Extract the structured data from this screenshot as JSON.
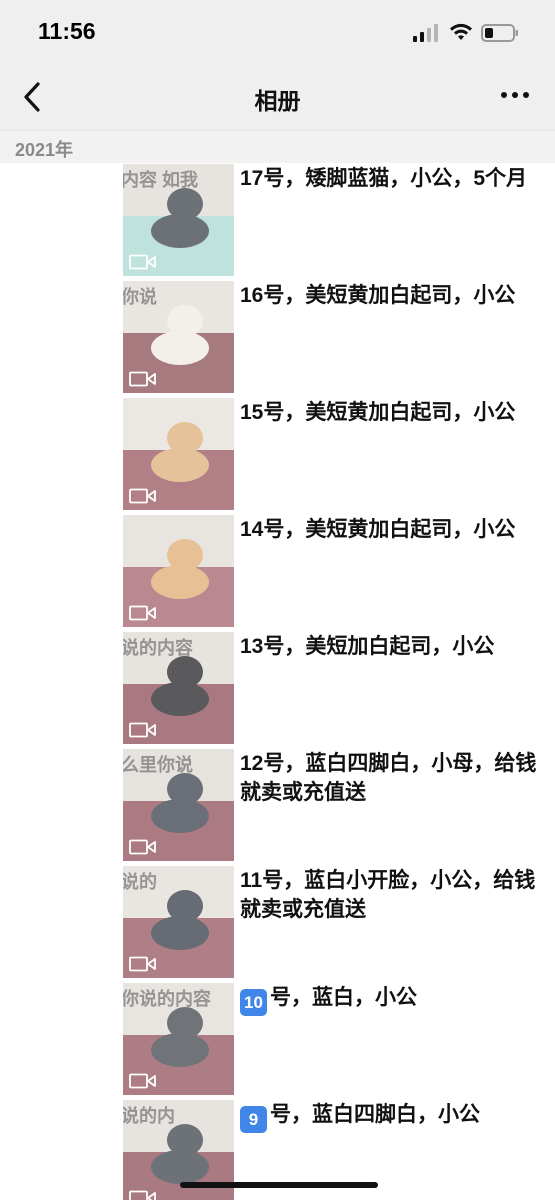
{
  "status_bar": {
    "time": "11:56"
  },
  "nav": {
    "title": "相册"
  },
  "year": "2021年",
  "items": [
    {
      "caption": "17号，矮脚蓝猫，小公，5个月",
      "wall": "#e7e4df",
      "floor": "#bfe2dc",
      "cat": "#6c7178",
      "wall_text": "内容  如我"
    },
    {
      "caption": "16号，美短黄加白起司，小公",
      "wall": "#e9e6e2",
      "floor": "#a77a80",
      "cat": "#f3efe9",
      "wall_text": "你说"
    },
    {
      "caption": "15号，美短黄加白起司，小公",
      "wall": "#ebe8e4",
      "floor": "#b27f86",
      "cat": "#e6c29b",
      "wall_text": ""
    },
    {
      "caption": "14号，美短黄加白起司，小公",
      "wall": "#e8e5e1",
      "floor": "#b98891",
      "cat": "#e8c096",
      "wall_text": ""
    },
    {
      "caption": "13号，美短加白起司，小公",
      "wall": "#e7e3de",
      "floor": "#a97880",
      "cat": "#5a5a5c",
      "wall_text": "说的内容"
    },
    {
      "caption": "12号，蓝白四脚白，小母，给钱就卖或充值送",
      "wall": "#e6e2dd",
      "floor": "#ab7a82",
      "cat": "#6a6e76",
      "wall_text": "么里你说"
    },
    {
      "caption": "11号，蓝白小开脸，小公，给钱就卖或充值送",
      "wall": "#e9e6e1",
      "floor": "#b07e86",
      "cat": "#676b73",
      "wall_text": "说的"
    },
    {
      "caption": "号，蓝白，小公",
      "badge": "10",
      "wall": "#e8e5e0",
      "floor": "#ad7c84",
      "cat": "#707479",
      "wall_text": "你说的内容"
    },
    {
      "caption": "号，蓝白四脚白，小公",
      "badge": "9",
      "wall": "#e7e4df",
      "floor": "#aa7a82",
      "cat": "#6d7178",
      "wall_text": "说的内"
    }
  ]
}
